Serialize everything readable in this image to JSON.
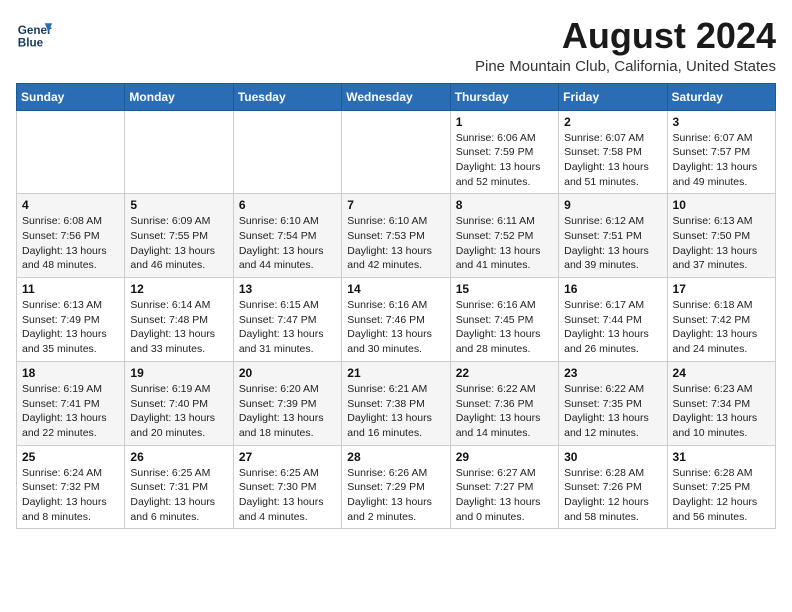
{
  "header": {
    "logo_line1": "General",
    "logo_line2": "Blue",
    "title": "August 2024",
    "subtitle": "Pine Mountain Club, California, United States"
  },
  "weekdays": [
    "Sunday",
    "Monday",
    "Tuesday",
    "Wednesday",
    "Thursday",
    "Friday",
    "Saturday"
  ],
  "weeks": [
    [
      {
        "day": "",
        "info": ""
      },
      {
        "day": "",
        "info": ""
      },
      {
        "day": "",
        "info": ""
      },
      {
        "day": "",
        "info": ""
      },
      {
        "day": "1",
        "info": "Sunrise: 6:06 AM\nSunset: 7:59 PM\nDaylight: 13 hours\nand 52 minutes."
      },
      {
        "day": "2",
        "info": "Sunrise: 6:07 AM\nSunset: 7:58 PM\nDaylight: 13 hours\nand 51 minutes."
      },
      {
        "day": "3",
        "info": "Sunrise: 6:07 AM\nSunset: 7:57 PM\nDaylight: 13 hours\nand 49 minutes."
      }
    ],
    [
      {
        "day": "4",
        "info": "Sunrise: 6:08 AM\nSunset: 7:56 PM\nDaylight: 13 hours\nand 48 minutes."
      },
      {
        "day": "5",
        "info": "Sunrise: 6:09 AM\nSunset: 7:55 PM\nDaylight: 13 hours\nand 46 minutes."
      },
      {
        "day": "6",
        "info": "Sunrise: 6:10 AM\nSunset: 7:54 PM\nDaylight: 13 hours\nand 44 minutes."
      },
      {
        "day": "7",
        "info": "Sunrise: 6:10 AM\nSunset: 7:53 PM\nDaylight: 13 hours\nand 42 minutes."
      },
      {
        "day": "8",
        "info": "Sunrise: 6:11 AM\nSunset: 7:52 PM\nDaylight: 13 hours\nand 41 minutes."
      },
      {
        "day": "9",
        "info": "Sunrise: 6:12 AM\nSunset: 7:51 PM\nDaylight: 13 hours\nand 39 minutes."
      },
      {
        "day": "10",
        "info": "Sunrise: 6:13 AM\nSunset: 7:50 PM\nDaylight: 13 hours\nand 37 minutes."
      }
    ],
    [
      {
        "day": "11",
        "info": "Sunrise: 6:13 AM\nSunset: 7:49 PM\nDaylight: 13 hours\nand 35 minutes."
      },
      {
        "day": "12",
        "info": "Sunrise: 6:14 AM\nSunset: 7:48 PM\nDaylight: 13 hours\nand 33 minutes."
      },
      {
        "day": "13",
        "info": "Sunrise: 6:15 AM\nSunset: 7:47 PM\nDaylight: 13 hours\nand 31 minutes."
      },
      {
        "day": "14",
        "info": "Sunrise: 6:16 AM\nSunset: 7:46 PM\nDaylight: 13 hours\nand 30 minutes."
      },
      {
        "day": "15",
        "info": "Sunrise: 6:16 AM\nSunset: 7:45 PM\nDaylight: 13 hours\nand 28 minutes."
      },
      {
        "day": "16",
        "info": "Sunrise: 6:17 AM\nSunset: 7:44 PM\nDaylight: 13 hours\nand 26 minutes."
      },
      {
        "day": "17",
        "info": "Sunrise: 6:18 AM\nSunset: 7:42 PM\nDaylight: 13 hours\nand 24 minutes."
      }
    ],
    [
      {
        "day": "18",
        "info": "Sunrise: 6:19 AM\nSunset: 7:41 PM\nDaylight: 13 hours\nand 22 minutes."
      },
      {
        "day": "19",
        "info": "Sunrise: 6:19 AM\nSunset: 7:40 PM\nDaylight: 13 hours\nand 20 minutes."
      },
      {
        "day": "20",
        "info": "Sunrise: 6:20 AM\nSunset: 7:39 PM\nDaylight: 13 hours\nand 18 minutes."
      },
      {
        "day": "21",
        "info": "Sunrise: 6:21 AM\nSunset: 7:38 PM\nDaylight: 13 hours\nand 16 minutes."
      },
      {
        "day": "22",
        "info": "Sunrise: 6:22 AM\nSunset: 7:36 PM\nDaylight: 13 hours\nand 14 minutes."
      },
      {
        "day": "23",
        "info": "Sunrise: 6:22 AM\nSunset: 7:35 PM\nDaylight: 13 hours\nand 12 minutes."
      },
      {
        "day": "24",
        "info": "Sunrise: 6:23 AM\nSunset: 7:34 PM\nDaylight: 13 hours\nand 10 minutes."
      }
    ],
    [
      {
        "day": "25",
        "info": "Sunrise: 6:24 AM\nSunset: 7:32 PM\nDaylight: 13 hours\nand 8 minutes."
      },
      {
        "day": "26",
        "info": "Sunrise: 6:25 AM\nSunset: 7:31 PM\nDaylight: 13 hours\nand 6 minutes."
      },
      {
        "day": "27",
        "info": "Sunrise: 6:25 AM\nSunset: 7:30 PM\nDaylight: 13 hours\nand 4 minutes."
      },
      {
        "day": "28",
        "info": "Sunrise: 6:26 AM\nSunset: 7:29 PM\nDaylight: 13 hours\nand 2 minutes."
      },
      {
        "day": "29",
        "info": "Sunrise: 6:27 AM\nSunset: 7:27 PM\nDaylight: 13 hours\nand 0 minutes."
      },
      {
        "day": "30",
        "info": "Sunrise: 6:28 AM\nSunset: 7:26 PM\nDaylight: 12 hours\nand 58 minutes."
      },
      {
        "day": "31",
        "info": "Sunrise: 6:28 AM\nSunset: 7:25 PM\nDaylight: 12 hours\nand 56 minutes."
      }
    ]
  ]
}
